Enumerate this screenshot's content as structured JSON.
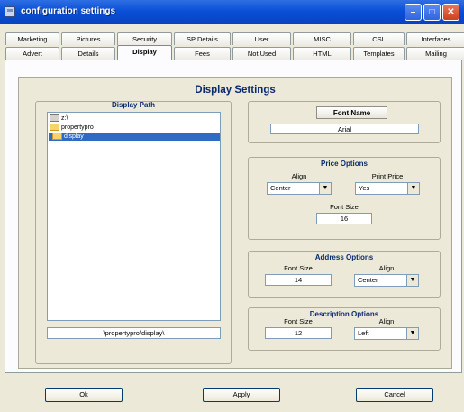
{
  "window": {
    "title": "configuration settings"
  },
  "tabs_top": [
    "Marketing",
    "Pictures",
    "Security",
    "SP Details",
    "User",
    "MISC",
    "CSL",
    "Interfaces"
  ],
  "tabs_bottom": [
    "Advert",
    "Details",
    "Display",
    "Fees",
    "Not Used",
    "HTML",
    "Templates",
    "Mailing"
  ],
  "active_tab": "Display",
  "page": {
    "heading": "Display Settings",
    "display_path": {
      "title": "Display Path",
      "tree": [
        {
          "label": "z:\\",
          "icon": "drive-icon"
        },
        {
          "label": "propertypro",
          "icon": "folder-icon"
        },
        {
          "label": "display",
          "icon": "folder-open-icon",
          "selected": true
        }
      ],
      "path_value": "\\propertypro\\display\\"
    },
    "font": {
      "button_label": "Font Name",
      "value": "Arial"
    },
    "price": {
      "title": "Price Options",
      "align_label": "Align",
      "align_value": "Center",
      "print_label": "Print Price",
      "print_value": "Yes",
      "size_label": "Font Size",
      "size_value": "16"
    },
    "address": {
      "title": "Address Options",
      "size_label": "Font Size",
      "size_value": "14",
      "align_label": "Align",
      "align_value": "Center"
    },
    "description": {
      "title": "Description Options",
      "size_label": "Font Size",
      "size_value": "12",
      "align_label": "Align",
      "align_value": "Left"
    }
  },
  "footer": {
    "ok": "Ok",
    "apply": "Apply",
    "cancel": "Cancel"
  }
}
